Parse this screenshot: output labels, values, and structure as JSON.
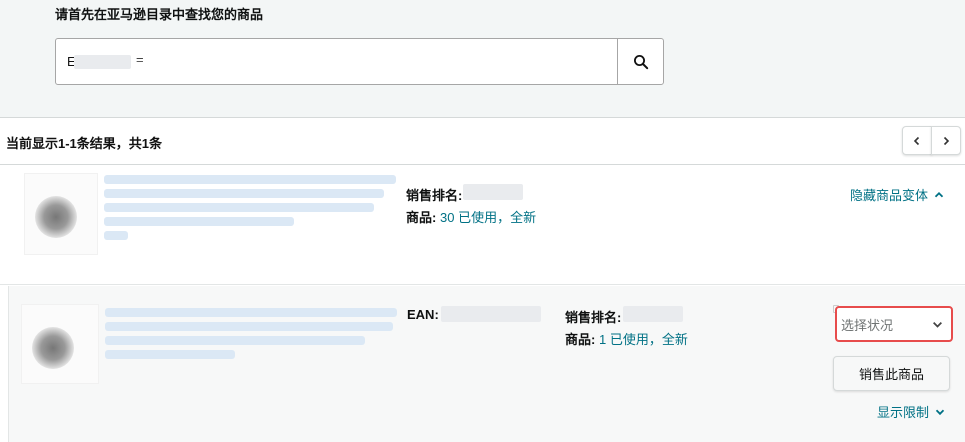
{
  "search": {
    "heading": "请首先在亚马逊目录中查找您的商品",
    "value_prefix": "E",
    "value_suffix": "=",
    "icon": "search-icon"
  },
  "results": {
    "count_text": "当前显示1-1条结果，共1条",
    "prev_icon": "chevron-left-icon",
    "next_icon": "chevron-right-icon"
  },
  "parent_item": {
    "sales_rank_label": "销售排名:",
    "offers_label": "商品:",
    "offers_value": "30 已使用，全新",
    "toggle_label": "隐藏商品变体"
  },
  "variant_item": {
    "ean_label": "EAN:",
    "sales_rank_label": "销售排名:",
    "offers_label": "商品:",
    "offers_value": "1 已使用，全新",
    "condition_placeholder": "选择状况",
    "sell_button": "销售此商品",
    "restrictions_label": "显示限制"
  },
  "colors": {
    "link": "#007185",
    "highlight_border": "#e74c4c",
    "search_bg": "#f3f6f6"
  }
}
